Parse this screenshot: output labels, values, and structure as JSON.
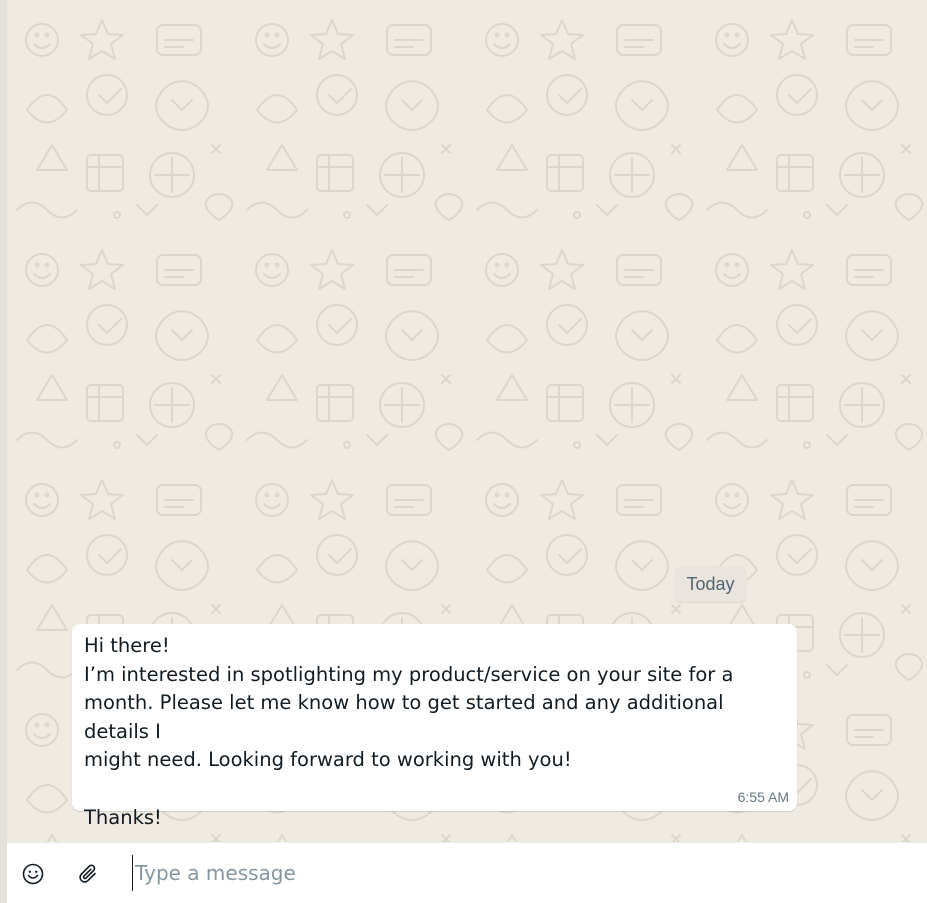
{
  "chat": {
    "date_divider": "Today",
    "messages": [
      {
        "text": "Hi there!\nI’m interested in spotlighting my product/service on your site for a\nmonth. Please let me know how to get started and any additional details I\nmight need. Looking forward to working with you!\n\nThanks!",
        "time": "6:55 AM"
      }
    ]
  },
  "composer": {
    "placeholder": "Type a message",
    "value": "",
    "emoji_icon": "smiley-icon",
    "attach_icon": "paperclip-icon"
  },
  "colors": {
    "wallpaper": "#efeae2",
    "bubble": "#ffffff",
    "text": "#111b21",
    "meta": "#667781",
    "placeholder": "#8696a0"
  }
}
